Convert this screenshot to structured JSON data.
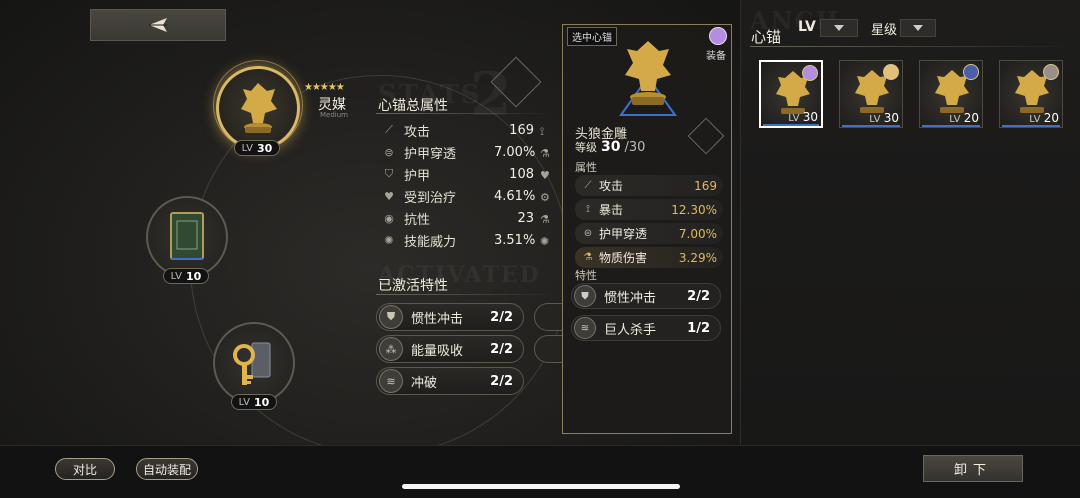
{
  "header": {
    "back_icon": "back-arrow-icon"
  },
  "slots": [
    {
      "name": "灵媒",
      "subname": "Medium",
      "lv_label": "LV",
      "lv": "30",
      "stars": "★★★★★",
      "icon": "golden-wolf-bust-icon"
    },
    {
      "lv_label": "LV",
      "lv": "10",
      "icon": "green-book-icon"
    },
    {
      "lv_label": "LV",
      "lv": "10",
      "icon": "golden-key-icon"
    }
  ],
  "total_stats": {
    "title": "心锚总属性",
    "rows": [
      {
        "icon": "attack-icon",
        "name": "攻击",
        "value": "169"
      },
      {
        "icon": "armor-pen-icon",
        "name": "护甲穿透",
        "value": "7.00%"
      },
      {
        "icon": "armor-icon",
        "name": "护甲",
        "value": "108"
      },
      {
        "icon": "healing-icon",
        "name": "受到治疗",
        "value": "4.61%"
      },
      {
        "icon": "resist-icon",
        "name": "抗性",
        "value": "23"
      },
      {
        "icon": "skill-icon",
        "name": "技能威力",
        "value": "3.51%"
      }
    ]
  },
  "active_traits": {
    "title": "已激活特性",
    "items": [
      {
        "icon": "shield-trait-icon",
        "name": "惯性冲击",
        "count": "2/2"
      },
      {
        "icon": "orbs-trait-icon",
        "name": "能量吸收",
        "count": "2/2"
      },
      {
        "icon": "swirl-trait-icon",
        "name": "冲破",
        "count": "2/2"
      }
    ]
  },
  "popup": {
    "tag": "选中心锚",
    "equip_label": "装备",
    "item_name": "头狼金雕",
    "level_label": "等级",
    "level": "30",
    "level_max": "/30",
    "attr_label": "属性",
    "stats": [
      {
        "icon": "attack-icon",
        "name": "攻击",
        "value": "169"
      },
      {
        "icon": "crit-icon",
        "name": "暴击",
        "value": "12.30%"
      },
      {
        "icon": "armor-pen-icon",
        "name": "护甲穿透",
        "value": "7.00%"
      },
      {
        "icon": "physical-dmg-icon",
        "name": "物质伤害",
        "value": "3.29%"
      }
    ],
    "trait_label": "特性",
    "traits": [
      {
        "icon": "shield-trait-icon",
        "name": "惯性冲击",
        "count": "2/2"
      },
      {
        "icon": "swirl-trait-icon",
        "name": "巨人杀手",
        "count": "1/2"
      }
    ]
  },
  "right_panel": {
    "title": "心锚",
    "sort_lv": "LV",
    "sort_star": "星级",
    "cards": [
      {
        "lv_label": "LV",
        "lv": "30",
        "avatar_color": "#b48ce0",
        "selected": true
      },
      {
        "lv_label": "LV",
        "lv": "30",
        "avatar_color": "#e2c07a",
        "selected": false
      },
      {
        "lv_label": "LV",
        "lv": "20",
        "avatar_color": "#4a5fa8",
        "selected": false
      },
      {
        "lv_label": "LV",
        "lv": "20",
        "avatar_color": "#9a8f88",
        "selected": false
      }
    ]
  },
  "bottom": {
    "compare_label": "对比",
    "auto_equip_label": "自动装配",
    "unequip_label": "卸下"
  },
  "colors": {
    "accent_gold": "#d9b868",
    "value_gold": "#e2b85e",
    "selection_blue": "#3f70c9"
  }
}
